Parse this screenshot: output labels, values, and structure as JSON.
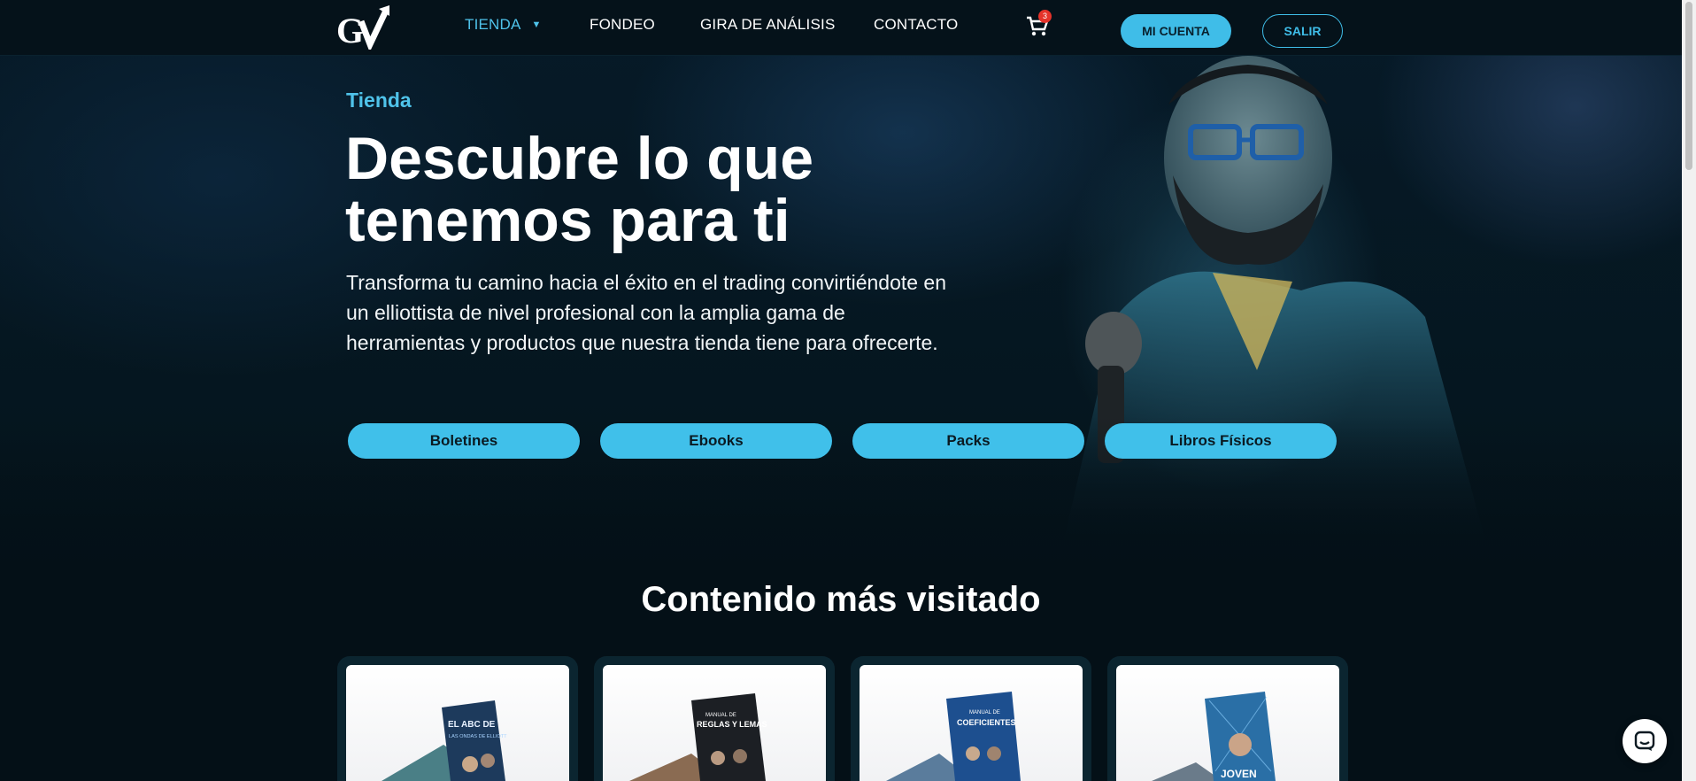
{
  "header": {
    "logo_alt": "GV",
    "nav": [
      {
        "label": "TIENDA",
        "active": true,
        "has_dropdown": true
      },
      {
        "label": "FONDEO"
      },
      {
        "label": "GIRA DE ANÁLISIS"
      },
      {
        "label": "CONTACTO"
      }
    ],
    "cart_count": "3",
    "account_button": "MI CUENTA",
    "logout_button": "SALIR"
  },
  "hero": {
    "eyebrow": "Tienda",
    "title_line1": "Descubre lo que",
    "title_line2": "tenemos para ti",
    "description": "Transforma tu camino hacia el éxito en el trading convirtiéndote en un elliottista de nivel profesional con la amplia gama de herramientas y productos que nuestra tienda tiene para ofrecerte.",
    "categories": [
      "Boletines",
      "Ebooks",
      "Packs",
      "Libros Físicos"
    ]
  },
  "popular": {
    "title": "Contenido más visitado",
    "products": [
      {
        "cover_text_1": "EL ABC DE",
        "cover_text_2": "LAS ONDAS DE ELLIOTT",
        "color": "#1d3a5c"
      },
      {
        "cover_text_1": "MANUAL DE",
        "cover_text_2": "REGLAS Y LEMAS",
        "color": "#1c1f24"
      },
      {
        "cover_text_1": "MANUAL DE",
        "cover_text_2": "COEFICIENTES",
        "color": "#1d4f8f"
      },
      {
        "cover_text_1": "",
        "cover_text_2": "JOVEN",
        "color": "#2a6fa6"
      }
    ]
  },
  "colors": {
    "accent": "#40c0ea",
    "background": "#041017",
    "badge": "#e5332a"
  },
  "icons": {
    "cart": "cart-icon",
    "chat": "chat-icon",
    "caret": "chevron-down-icon"
  }
}
